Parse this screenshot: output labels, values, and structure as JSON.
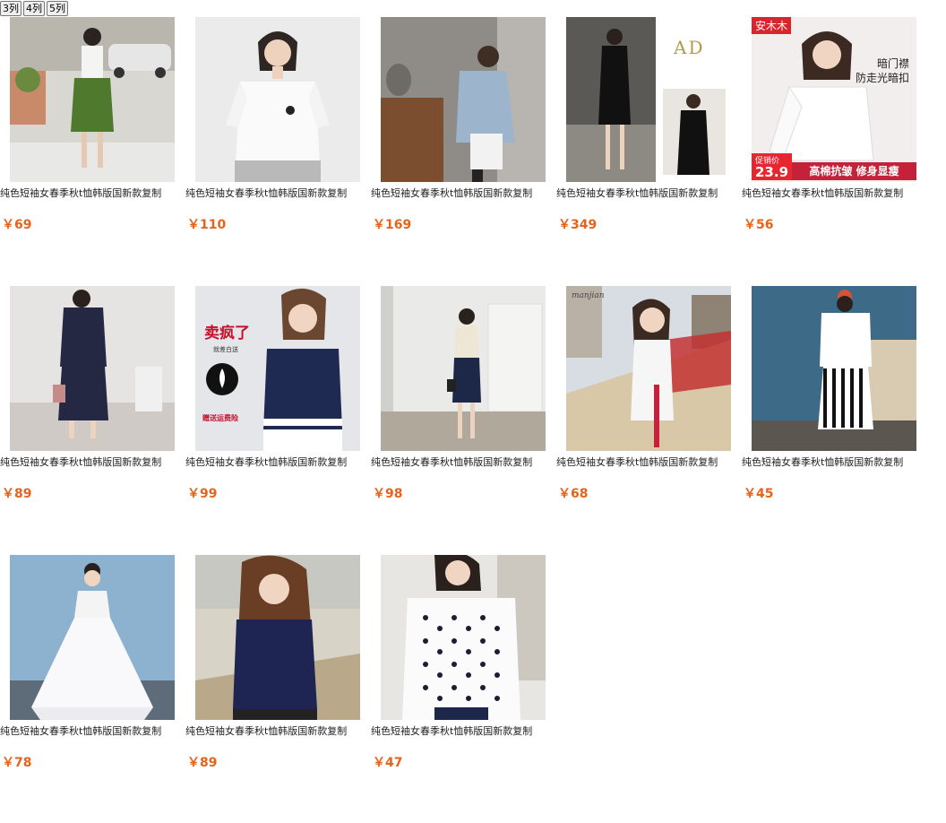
{
  "toolbar": {
    "buttons": [
      "3列",
      "4列",
      "5列"
    ]
  },
  "products": [
    {
      "title": "纯色短袖女春季秋t恤韩版国新款复制",
      "price": "￥69"
    },
    {
      "title": "纯色短袖女春季秋t恤韩版国新款复制",
      "price": "￥110"
    },
    {
      "title": "纯色短袖女春季秋t恤韩版国新款复制",
      "price": "￥169"
    },
    {
      "title": "纯色短袖女春季秋t恤韩版国新款复制",
      "price": "￥349",
      "overlay": {
        "brand": "AD"
      }
    },
    {
      "title": "纯色短袖女春季秋t恤韩版国新款复制",
      "price": "￥56",
      "overlay": {
        "badge": "安木木",
        "side_line1": "暗门襟",
        "side_line2": "防走光暗扣",
        "promo_label": "促销价",
        "promo_price": "23.9",
        "promo_text": "高棉抗皱 修身显瘦"
      }
    },
    {
      "title": "纯色短袖女春季秋t恤韩版国新款复制",
      "price": "￥89"
    },
    {
      "title": "纯色短袖女春季秋t恤韩版国新款复制",
      "price": "￥99",
      "overlay": {
        "headline": "卖疯了",
        "sub": "就差白送",
        "fabric": "桑蚕丝面料",
        "bottom": "赠送运费险"
      }
    },
    {
      "title": "纯色短袖女春季秋t恤韩版国新款复制",
      "price": "￥98"
    },
    {
      "title": "纯色短袖女春季秋t恤韩版国新款复制",
      "price": "￥68",
      "overlay": {
        "script": "manjian"
      }
    },
    {
      "title": "纯色短袖女春季秋t恤韩版国新款复制",
      "price": "￥45"
    },
    {
      "title": "纯色短袖女春季秋t恤韩版国新款复制",
      "price": "￥78"
    },
    {
      "title": "纯色短袖女春季秋t恤韩版国新款复制",
      "price": "￥89"
    },
    {
      "title": "纯色短袖女春季秋t恤韩版国新款复制",
      "price": "￥47"
    }
  ],
  "colors": {
    "price": "#e8621a",
    "promo_red": "#e8262f"
  }
}
